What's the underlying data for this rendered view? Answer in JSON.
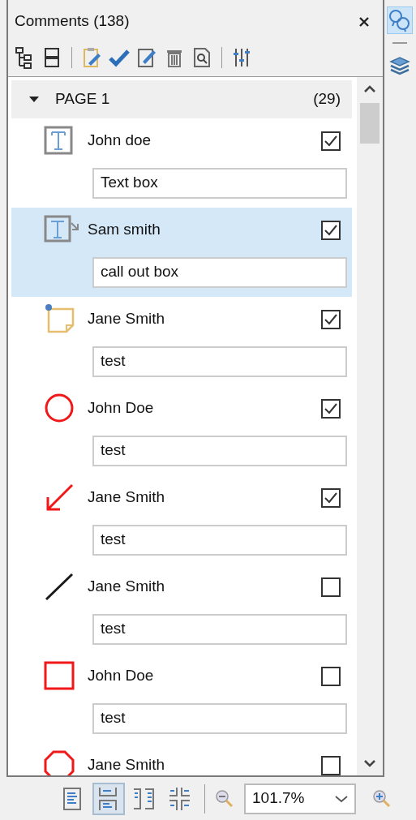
{
  "panel": {
    "title": "Comments (138)"
  },
  "rail_buttons": [
    {
      "selected": true
    },
    {
      "selected": false
    }
  ],
  "group": {
    "label": "PAGE 1",
    "count": "(29)",
    "expanded": true,
    "comments": [
      {
        "kind": "textbox",
        "author": "John doe",
        "checked": true,
        "text": "Text box",
        "selected": false
      },
      {
        "kind": "callout",
        "author": "Sam smith",
        "checked": true,
        "text": "call out box",
        "selected": true
      },
      {
        "kind": "note",
        "author": "Jane Smith",
        "checked": true,
        "text": "test",
        "selected": false
      },
      {
        "kind": "circle",
        "author": "John Doe",
        "checked": true,
        "text": "test",
        "selected": false
      },
      {
        "kind": "arrow",
        "author": "Jane Smith",
        "checked": true,
        "text": "test",
        "selected": false
      },
      {
        "kind": "line",
        "author": "Jane Smith",
        "checked": false,
        "text": "test",
        "selected": false
      },
      {
        "kind": "square",
        "author": "John Doe",
        "checked": false,
        "text": "test",
        "selected": false
      },
      {
        "kind": "polygon",
        "author": "Jane Smith",
        "checked": false,
        "selected": false
      }
    ]
  },
  "view_buttons": [
    {
      "selected": false
    },
    {
      "selected": true
    },
    {
      "selected": false
    },
    {
      "selected": false
    }
  ],
  "zoom": {
    "value": "101.7%"
  }
}
